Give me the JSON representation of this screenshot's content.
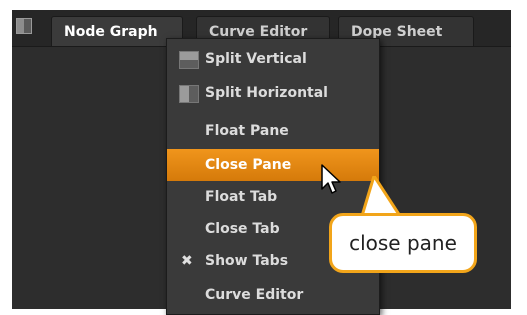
{
  "tabs": [
    {
      "label": "Node Graph",
      "active": true
    },
    {
      "label": "Curve Editor",
      "active": false
    },
    {
      "label": "Dope Sheet",
      "active": false
    }
  ],
  "menu": {
    "items": [
      {
        "label": "Split Vertical",
        "icon": "split-vertical-icon"
      },
      {
        "label": "Split Horizontal",
        "icon": "split-horizontal-icon"
      },
      {
        "label": "Float Pane"
      },
      {
        "label": "Close Pane",
        "highlighted": true
      },
      {
        "label": "Float Tab"
      },
      {
        "label": "Close Tab"
      },
      {
        "label": "Show Tabs",
        "checked_glyph": "✖"
      },
      {
        "label": "Curve Editor"
      }
    ]
  },
  "callout": {
    "text": "close pane"
  },
  "colors": {
    "highlight": "#e88a12",
    "callout_border": "#f2a51a",
    "panel_bg": "#2d2d2d",
    "menu_bg": "#3a3a3a"
  }
}
